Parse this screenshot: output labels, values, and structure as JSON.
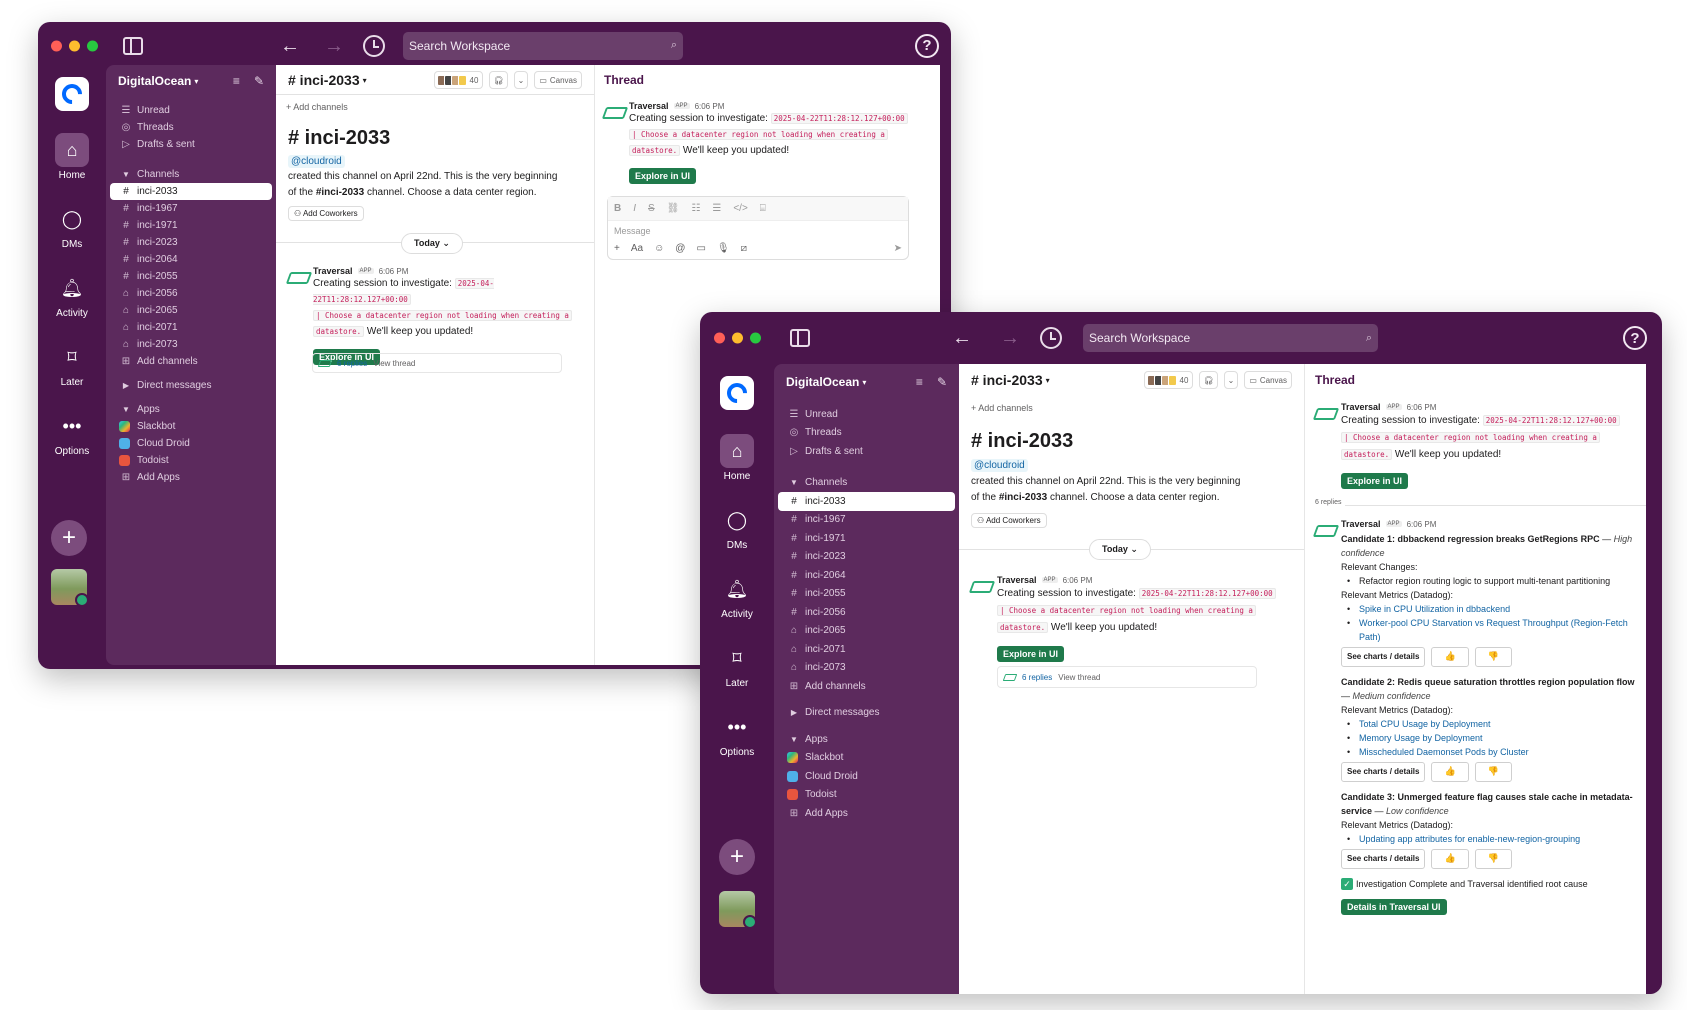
{
  "window": {
    "search_placeholder": "Search Workspace"
  },
  "rail": {
    "home": "Home",
    "dms": "DMs",
    "activity": "Activity",
    "later": "Later",
    "options": "Options"
  },
  "workspace": {
    "name": "DigitalOcean",
    "top_items": [
      "Unread",
      "Threads",
      "Drafts & sent"
    ],
    "channels_header": "Channels",
    "channels": [
      "inci-2033",
      "inci-1967",
      "inci-1971",
      "inci-2023",
      "inci-2064",
      "inci-2055",
      "inci-2056",
      "inci-2065",
      "inci-2071",
      "inci-2073"
    ],
    "add_channels": "Add channels",
    "dm_header": "Direct messages",
    "apps_header": "Apps",
    "apps": [
      "Slackbot",
      "Cloud Droid",
      "Todoist"
    ],
    "add_apps": "Add Apps"
  },
  "channel": {
    "title": "# inci-2033",
    "member_count": "40",
    "canvas": "Canvas",
    "add_channels": "Add channels",
    "big_title": "# inci-2033",
    "mention": "@cloudroid",
    "intro_1": "created this channel on April 22nd. This is the very beginning",
    "intro_2_prefix": "of the ",
    "intro_2_bold": "#inci-2033",
    "intro_2_suffix": " channel. Choose a data center region.",
    "add_coworkers": "Add Coworkers",
    "today": "Today"
  },
  "message": {
    "author": "Traversal",
    "tag": "APP",
    "time": "6:06 PM",
    "text_prefix": "Creating session to investigate: ",
    "code_timestamp": "2025-04-22T11:28:12.127+00:00",
    "code_query": "| Choose a datacenter region not loading when creating a",
    "code_query_2": "datastore.",
    "text_suffix": " We'll keep you updated!",
    "button": "Explore in UI",
    "replies": "6 replies",
    "view_thread": "View thread"
  },
  "thread": {
    "title": "Thread",
    "message_placeholder": "Message",
    "reply_count": "6 replies",
    "candidates": [
      {
        "title": "Candidate 1: dbbackend regression breaks GetRegions RPC",
        "confidence": "High confidence",
        "changes_label": "Relevant Changes:",
        "changes": [
          "Refactor region routing logic to support multi-tenant partitioning"
        ],
        "metrics_label": "Relevant Metrics (Datadog):",
        "metrics": [
          "Spike in CPU Utilization in dbbackend",
          "Worker-pool CPU Starvation vs Request Throughput (Region-Fetch Path)"
        ]
      },
      {
        "title": "Candidate 2: Redis queue saturation throttles region population flow",
        "confidence": "Medium confidence",
        "metrics_label": "Relevant Metrics (Datadog):",
        "metrics": [
          "Total CPU Usage by Deployment",
          "Memory Usage by Deployment",
          "Misscheduled Daemonset Pods by Cluster"
        ]
      },
      {
        "title": "Candidate 3: Unmerged feature flag causes stale cache in metadata-service",
        "confidence": "Low confidence",
        "metrics_label": "Relevant Metrics (Datadog):",
        "metrics": [
          "Updating app attributes for enable-new-region-grouping"
        ]
      }
    ],
    "see_charts": "See charts / details",
    "thumbs_up": "👍",
    "thumbs_down": "👎",
    "complete": "Investigation Complete and Traversal identified root cause",
    "details_button": "Details in Traversal UI"
  },
  "colors": {
    "aubergine": "#4a154b",
    "nav": "#5c2a5d",
    "green_button": "#1f7a4b",
    "link": "#1264a3"
  }
}
